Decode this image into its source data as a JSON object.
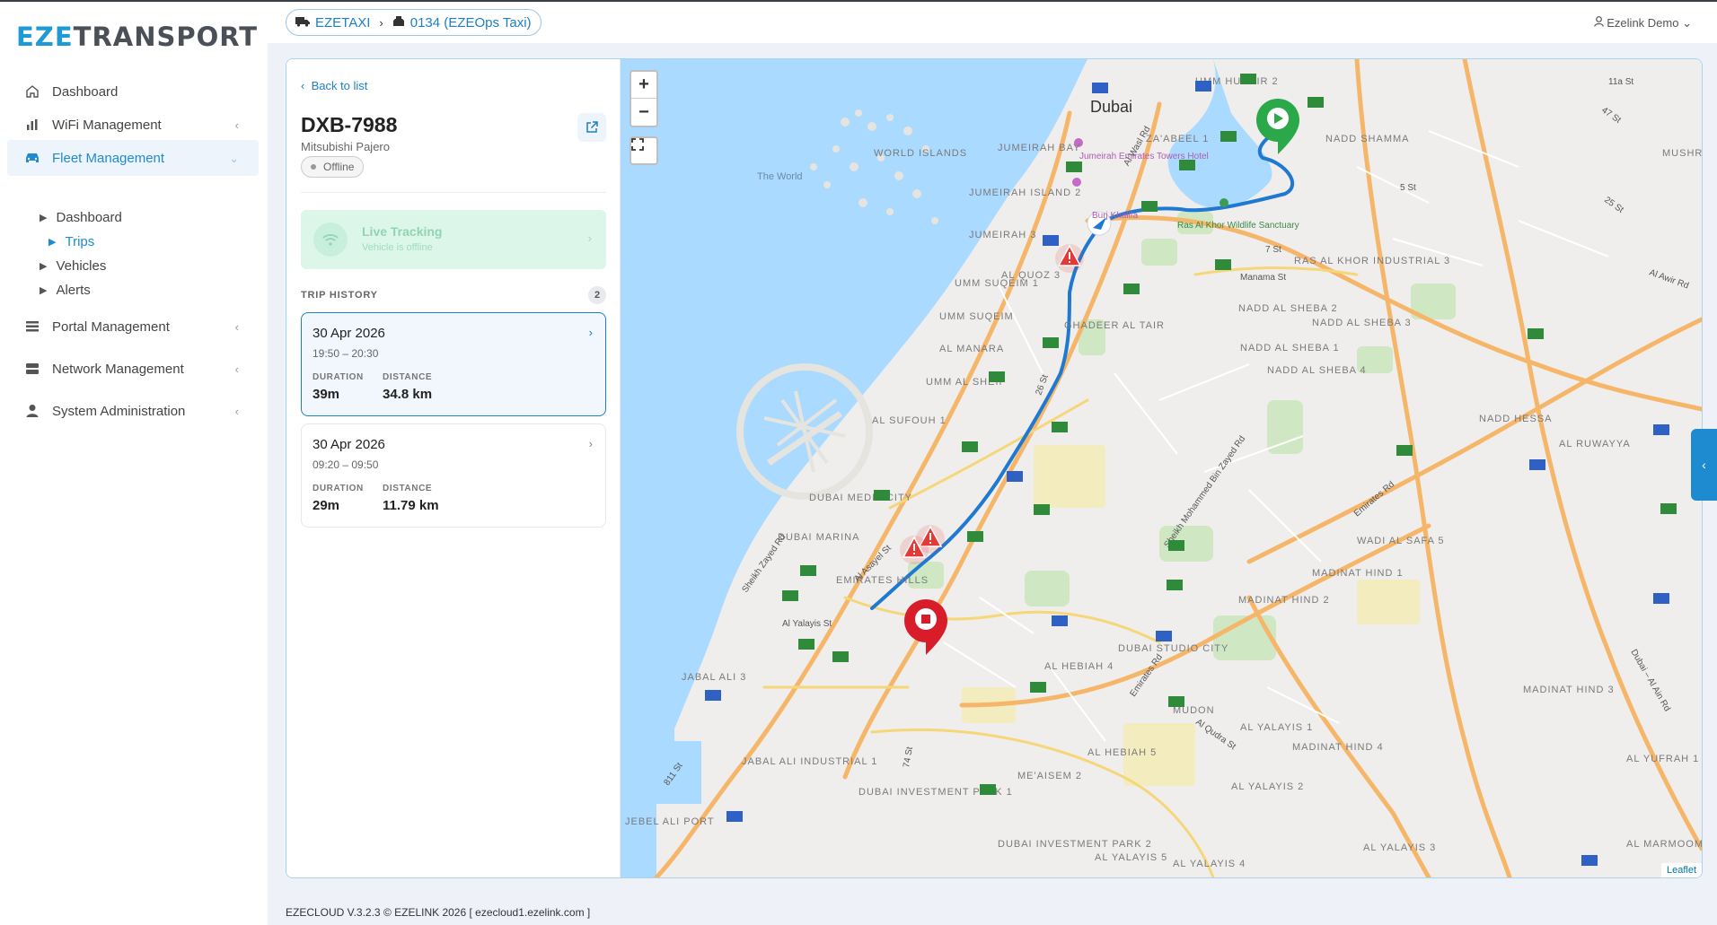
{
  "app": {
    "logo_prefix": "EZE",
    "logo_suffix": "TRANSPORT"
  },
  "sidebar": {
    "items": [
      {
        "label": "Dashboard",
        "icon": "home-icon"
      },
      {
        "label": "WiFi Management",
        "icon": "bar-chart-icon"
      },
      {
        "label": "Fleet Management",
        "icon": "car-icon"
      },
      {
        "label": "Portal Management",
        "icon": "list-icon"
      },
      {
        "label": "Network Management",
        "icon": "server-icon"
      },
      {
        "label": "System Administration",
        "icon": "user-icon"
      }
    ],
    "fleet_sub": [
      "Dashboard",
      "Trips",
      "Vehicles",
      "Alerts"
    ],
    "active_item": "Fleet Management",
    "active_sub": "Trips"
  },
  "header": {
    "breadcrumb": [
      "EZETAXI",
      "0134 (EZEOps Taxi)"
    ],
    "user": "Ezelink Demo"
  },
  "panel": {
    "back_label": "Back to list",
    "plate": "DXB-7988",
    "model": "Mitsubishi Pajero",
    "status": "Offline",
    "live_title": "Live Tracking",
    "live_sub": "Vehicle is offline",
    "trip_history_label": "TRIP HISTORY",
    "trip_count": "2",
    "duration_label": "DURATION",
    "distance_label": "DISTANCE",
    "trips": [
      {
        "date": "30 Apr 2026",
        "time": "19:50 – 20:30",
        "duration": "39m",
        "distance": "34.8 km",
        "selected": true
      },
      {
        "date": "30 Apr 2026",
        "time": "09:20 – 09:50",
        "duration": "29m",
        "distance": "11.79 km",
        "selected": false
      }
    ]
  },
  "map": {
    "zoom_in": "+",
    "zoom_out": "−",
    "attribution": "Leaflet",
    "labels": {
      "dubai": "Dubai",
      "world": "The World",
      "world_islands": "WORLD ISLANDS",
      "jumeirah_bay": "JUMEIRAH BAY",
      "jumeirah_island_2": "JUMEIRAH ISLAND 2",
      "jumeirah_3": "JUMEIRAH 3",
      "umm_suqeim_1": "UMM SUQEIM 1",
      "umm_suqeim": "UMM SUQEIM",
      "al_quoz_3": "AL QUOZ 3",
      "al_manara": "AL MANARA",
      "ghadeer_al_tair": "GHADEER AL TAIR",
      "umm_al_sheif": "UMM AL SHEIF",
      "al_sufouh_1": "AL SUFOUH 1",
      "dubai_media_city": "DUBAI MEDIA CITY",
      "dubai_marina": "DUBAI MARINA",
      "emirates_hills": "EMIRATES HILLS",
      "jabal_ali_3": "JABAL ALI 3",
      "jabal_ali_industrial_1": "JABAL ALI INDUSTRIAL 1",
      "jebel_ali_port": "JEBEL ALI PORT",
      "dubai_investment_park_1": "DUBAI INVESTMENT PARK 1",
      "dubai_investment_park_2": "DUBAI INVESTMENT PARK 2",
      "al_hebiah_4": "AL HEBIAH 4",
      "al_hebiah_5": "AL HEBIAH 5",
      "me_aisem_2": "ME'AISEM 2",
      "dubai_studio_city": "DUBAI STUDIO CITY",
      "mudon": "MUDON",
      "al_yalayis_1": "AL YALAYIS 1",
      "al_yalayis_2": "AL YALAYIS 2",
      "al_yalayis_3": "AL YALAYIS 3",
      "al_yalayis_4": "AL YALAYIS 4",
      "al_yalayis_5": "AL YALAYIS 5",
      "madinat_hind_1": "MADINAT HIND 1",
      "madinat_hind_2": "MADINAT HIND 2",
      "madinat_hind_3": "MADINAT HIND 3",
      "madinat_hind_4": "MADINAT HIND 4",
      "wadi_al_safa_5": "WADI AL SAFA 5",
      "al_yufrah_1": "AL YUFRAH 1",
      "al_marmoom": "AL MARMOOM",
      "nadd_hessa": "NADD HESSA",
      "al_ruwayyah": "AL RUWAYYA",
      "nadd_al_sheba_1": "NADD AL SHEBA 1",
      "nadd_al_sheba_2": "NADD AL SHEBA 2",
      "nadd_al_sheba_3": "NADD AL SHEBA 3",
      "nadd_al_sheba_4": "NADD AL SHEBA 4",
      "ras_al_khor": "RAS AL KHOR INDUSTRIAL 3",
      "nadd_shamma": "NADD SHAMMA",
      "mushrif": "MUSHRI",
      "umm_hurair": "UMM HURAIR 2",
      "zaabeel": "ZA'ABEEL 1",
      "jumeirah_towers": "Jumeirah Emirates Towers Hotel",
      "burj_khalifa": "Burj Khalifa",
      "ras_al_khor_sanctuary": "Ras Al Khor Wildlife Sanctuary",
      "manama_st": "Manama St",
      "al_yalayis_st": "Al Yalayis St",
      "al_wasl_rd": "Al Wasl Rd",
      "st_26": "26 St",
      "al_asayel_st": "Al Asayel St",
      "sheikh_zayed_rd": "Sheikh Zayed Rd",
      "emirates_rd": "Emirates Rd",
      "emirates_rd_2": "Emirates Rd",
      "smbz_rd": "Sheikh Mohammed Bin Zayed Rd",
      "al_qudra_st": "Al Qudra St",
      "dubai_al_ain": "Dubai – Al Ain Rd",
      "al_awir_rd": "Al Awir Rd",
      "st_7": "7 St",
      "st_5": "5 St",
      "st_74": "74 St",
      "st_811": "811 St",
      "st_25": "25 St",
      "st_47": "47 St",
      "st_11a": "11a St"
    }
  },
  "footer": {
    "text": "EZECLOUD V.3.2.3 © EZELINK 2026  [ ezecloud1.ezelink.com ]"
  },
  "colors": {
    "accent": "#1e8bd0",
    "route": "#1f78d1",
    "start_marker": "#2aa84a",
    "end_marker": "#d91c2a",
    "alert": "#e53935",
    "water": "#aadaff"
  }
}
